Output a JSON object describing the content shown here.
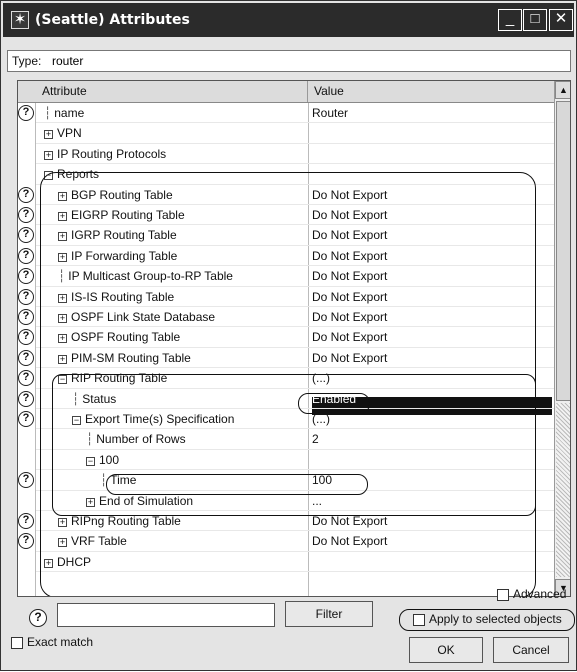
{
  "window": {
    "title": "(Seattle) Attributes",
    "icon": "star-icon",
    "controls": {
      "minimize": "_",
      "maximize": "□",
      "close": "✕"
    }
  },
  "type_field": {
    "label": "Type:",
    "value": "router"
  },
  "table": {
    "headers": {
      "attribute": "Attribute",
      "value": "Value"
    },
    "rows": [
      {
        "q": true,
        "indent": 0,
        "kind": "leaf",
        "label": "name",
        "value": "Router"
      },
      {
        "q": false,
        "indent": 0,
        "kind": "expand",
        "label": "VPN",
        "value": ""
      },
      {
        "q": false,
        "indent": 0,
        "kind": "expand",
        "label": "IP Routing Protocols",
        "value": ""
      },
      {
        "q": false,
        "indent": 0,
        "kind": "collapse",
        "label": "Reports",
        "value": ""
      },
      {
        "q": true,
        "indent": 1,
        "kind": "expand",
        "label": "BGP Routing Table",
        "value": "Do Not Export"
      },
      {
        "q": true,
        "indent": 1,
        "kind": "expand",
        "label": "EIGRP Routing Table",
        "value": "Do Not Export"
      },
      {
        "q": true,
        "indent": 1,
        "kind": "expand",
        "label": "IGRP Routing Table",
        "value": "Do Not Export"
      },
      {
        "q": true,
        "indent": 1,
        "kind": "expand",
        "label": "IP Forwarding Table",
        "value": "Do Not Export"
      },
      {
        "q": true,
        "indent": 1,
        "kind": "leaf",
        "label": "IP Multicast Group-to-RP Table",
        "value": "Do Not Export"
      },
      {
        "q": true,
        "indent": 1,
        "kind": "expand",
        "label": "IS-IS Routing Table",
        "value": "Do Not Export"
      },
      {
        "q": true,
        "indent": 1,
        "kind": "expand",
        "label": "OSPF Link State Database",
        "value": "Do Not Export"
      },
      {
        "q": true,
        "indent": 1,
        "kind": "expand",
        "label": "OSPF Routing Table",
        "value": "Do Not Export"
      },
      {
        "q": true,
        "indent": 1,
        "kind": "expand",
        "label": "PIM-SM Routing Table",
        "value": "Do Not Export"
      },
      {
        "q": true,
        "indent": 1,
        "kind": "collapse",
        "label": "RIP Routing Table",
        "value": "(...)"
      },
      {
        "q": true,
        "indent": 2,
        "kind": "leaf",
        "label": "Status",
        "value": "Enabled",
        "selected": true
      },
      {
        "q": true,
        "indent": 2,
        "kind": "collapse",
        "label": "Export Time(s) Specification",
        "value": "(...)"
      },
      {
        "q": false,
        "indent": 3,
        "kind": "leaf",
        "label": "Number of Rows",
        "value": "2"
      },
      {
        "q": false,
        "indent": 3,
        "kind": "collapse",
        "label": "100",
        "value": ""
      },
      {
        "q": true,
        "indent": 4,
        "kind": "leaf",
        "label": "Time",
        "value": "100"
      },
      {
        "q": false,
        "indent": 3,
        "kind": "expand",
        "label": "End of Simulation",
        "value": "..."
      },
      {
        "q": true,
        "indent": 1,
        "kind": "expand",
        "label": "RIPng Routing Table",
        "value": "Do Not Export"
      },
      {
        "q": true,
        "indent": 1,
        "kind": "expand",
        "label": "VRF Table",
        "value": "Do Not Export"
      },
      {
        "q": false,
        "indent": 0,
        "kind": "expand",
        "label": "DHCP",
        "value": ""
      }
    ]
  },
  "bottom": {
    "help_symbol": "?",
    "search_value": "",
    "filter_label": "Filter",
    "exact_match_label": "Exact match",
    "exact_match_checked": false,
    "advanced_label": "Advanced",
    "advanced_checked": false,
    "apply_label": "Apply to selected objects",
    "apply_checked": false,
    "ok_label": "OK",
    "cancel_label": "Cancel"
  },
  "colors": {
    "titlebar": "#2b2b2b",
    "selection": "#111111",
    "dialog_bg": "#e4e4e4"
  }
}
